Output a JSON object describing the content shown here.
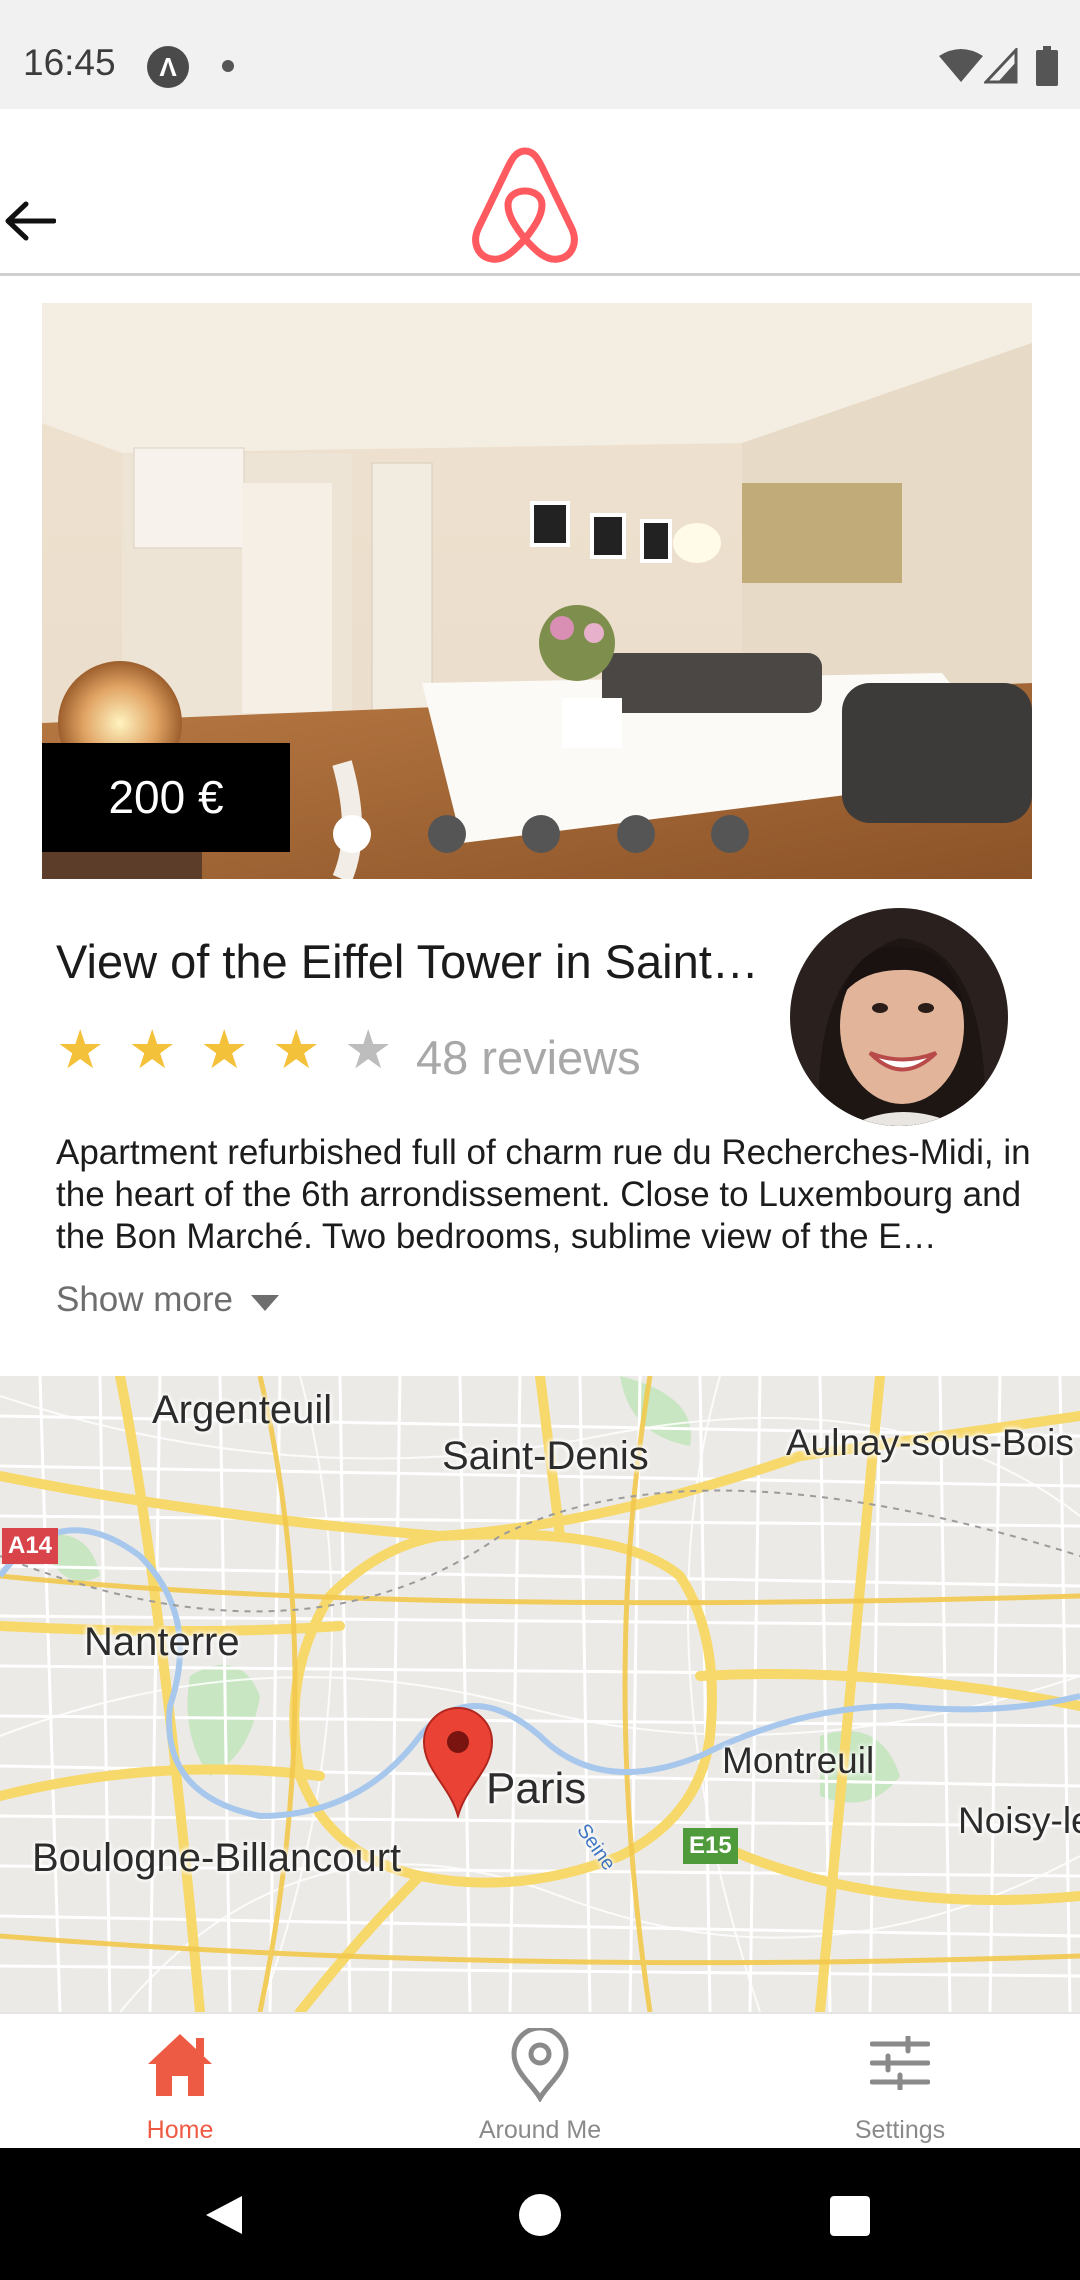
{
  "status_bar": {
    "time": "16:45",
    "notification_icon": "a-icon",
    "wifi": "wifi-icon",
    "signal": "signal-icon",
    "battery": "battery-icon"
  },
  "header": {
    "back_icon": "arrow-left-icon",
    "logo": "airbnb-logo"
  },
  "listing": {
    "price": "200 €",
    "carousel": {
      "count": 5,
      "active_index": 0
    },
    "title": "View of the Eiffel Tower in Saint…",
    "rating": 4,
    "rating_max": 5,
    "reviews": "48 reviews",
    "description": "Apartment refurbished full of charm rue du Recherches-Midi, in the heart of the 6th arrondissement. Close to Luxembourg and the Bon Marché. Two bedrooms, sublime view of the E…",
    "show_more": "Show more"
  },
  "map": {
    "labels": [
      "Argenteuil",
      "Saint-Denis",
      "Aulnay-sous-Bois",
      "Nanterre",
      "Paris",
      "Montreuil",
      "Noisy-le",
      "Boulogne-Billancourt",
      "Seine"
    ],
    "shields": [
      "A14",
      "E15"
    ]
  },
  "bottom_nav": {
    "items": [
      {
        "label": "Home",
        "icon": "home-icon",
        "active": true
      },
      {
        "label": "Around Me",
        "icon": "location-pin-icon",
        "active": false
      },
      {
        "label": "Settings",
        "icon": "sliders-icon",
        "active": false
      }
    ]
  },
  "colors": {
    "accent": "#ee5b45",
    "brand": "#ff5a5f",
    "star": "#f4c13a",
    "star_empty": "#bdbdbd"
  }
}
